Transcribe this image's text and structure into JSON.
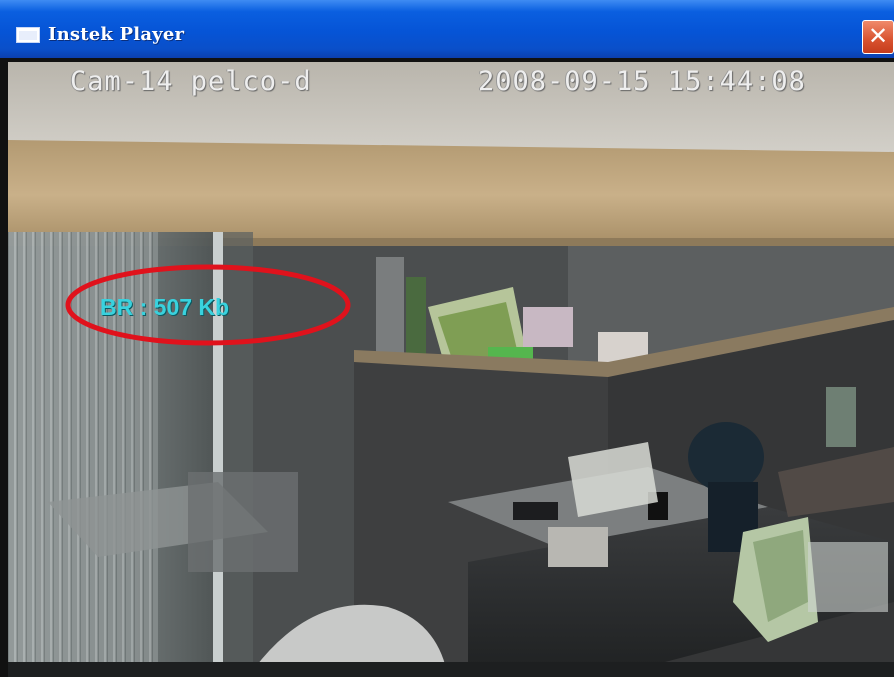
{
  "window": {
    "title": "Instek Player",
    "close_symbol": "✕"
  },
  "video": {
    "osd_camera": "Cam-14 pelco-d",
    "osd_timestamp": "2008-09-15 15:44:08",
    "bitrate_label": "BR : 507 Kb",
    "highlight_color": "#e0121c",
    "bitrate_color": "#39d2de"
  },
  "icons": {
    "window_icon": "app-window-icon",
    "close": "close-icon"
  }
}
